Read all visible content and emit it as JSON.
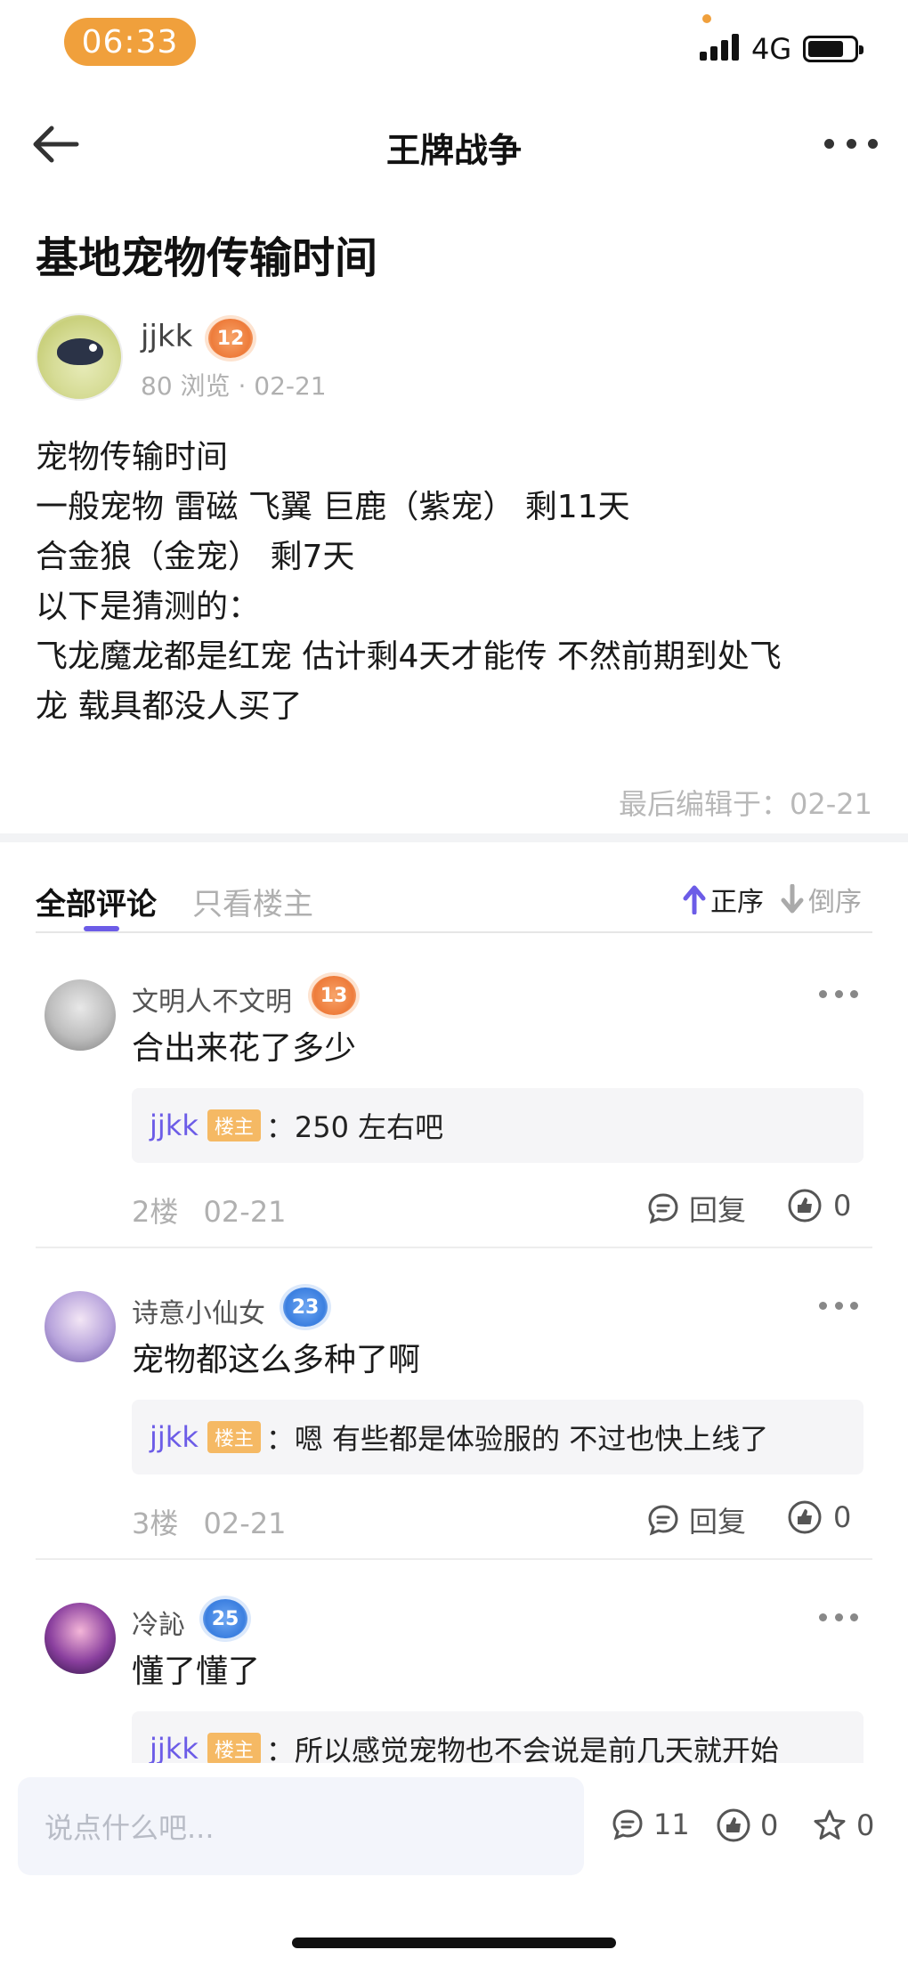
{
  "status_bar": {
    "time": "06:33",
    "network": "4G"
  },
  "nav": {
    "title": "王牌战争"
  },
  "post": {
    "title": "基地宠物传输时间",
    "author": {
      "name": "jjkk",
      "level": "12"
    },
    "views": "80 浏览",
    "date": "02-21",
    "body_lines": [
      "宠物传输时间",
      "一般宠物 雷磁 飞翼 巨鹿（紫宠） 剩11天",
      "合金狼（金宠） 剩7天",
      "以下是猜测的：",
      "飞龙魔龙都是红宠 估计剩4天才能传 不然前期到处飞",
      "龙 载具都没人买了"
    ],
    "edited": "最后编辑于：02-21"
  },
  "tabs": {
    "all": "全部评论",
    "op_only": "只看楼主",
    "sort_asc": "正序",
    "sort_desc": "倒序"
  },
  "comments": [
    {
      "name": "文明人不文明",
      "level": "13",
      "level_color": "#ee7c3b",
      "text": "合出来花了多少",
      "reply": {
        "user": "jjkk",
        "tag": "楼主",
        "sep": "：",
        "text": "250 左右吧"
      },
      "floor": "2楼",
      "date": "02-21",
      "reply_label": "回复",
      "likes": "0"
    },
    {
      "name": "诗意小仙女",
      "level": "23",
      "level_color": "#3b7fe0",
      "text": "宠物都这么多种了啊",
      "reply": {
        "user": "jjkk",
        "tag": "楼主",
        "sep": "：",
        "text": "嗯 有些都是体验服的 不过也快上线了"
      },
      "floor": "3楼",
      "date": "02-21",
      "reply_label": "回复",
      "likes": "0"
    },
    {
      "name": "冷訫",
      "level": "25",
      "level_color": "#3b7fe0",
      "text": "懂了懂了",
      "reply": {
        "user": "jjkk",
        "tag": "楼主",
        "sep": "：",
        "text": "所以感觉宠物也不会说是前几天就开始"
      }
    }
  ],
  "bottom_bar": {
    "input_placeholder": "说点什么吧...",
    "comments_count": "11",
    "likes_count": "0",
    "stars_count": "0"
  },
  "colors": {
    "accent": "#6c5ce7",
    "status_pill": "#f0a03c",
    "host_tag": "#f5b964"
  }
}
